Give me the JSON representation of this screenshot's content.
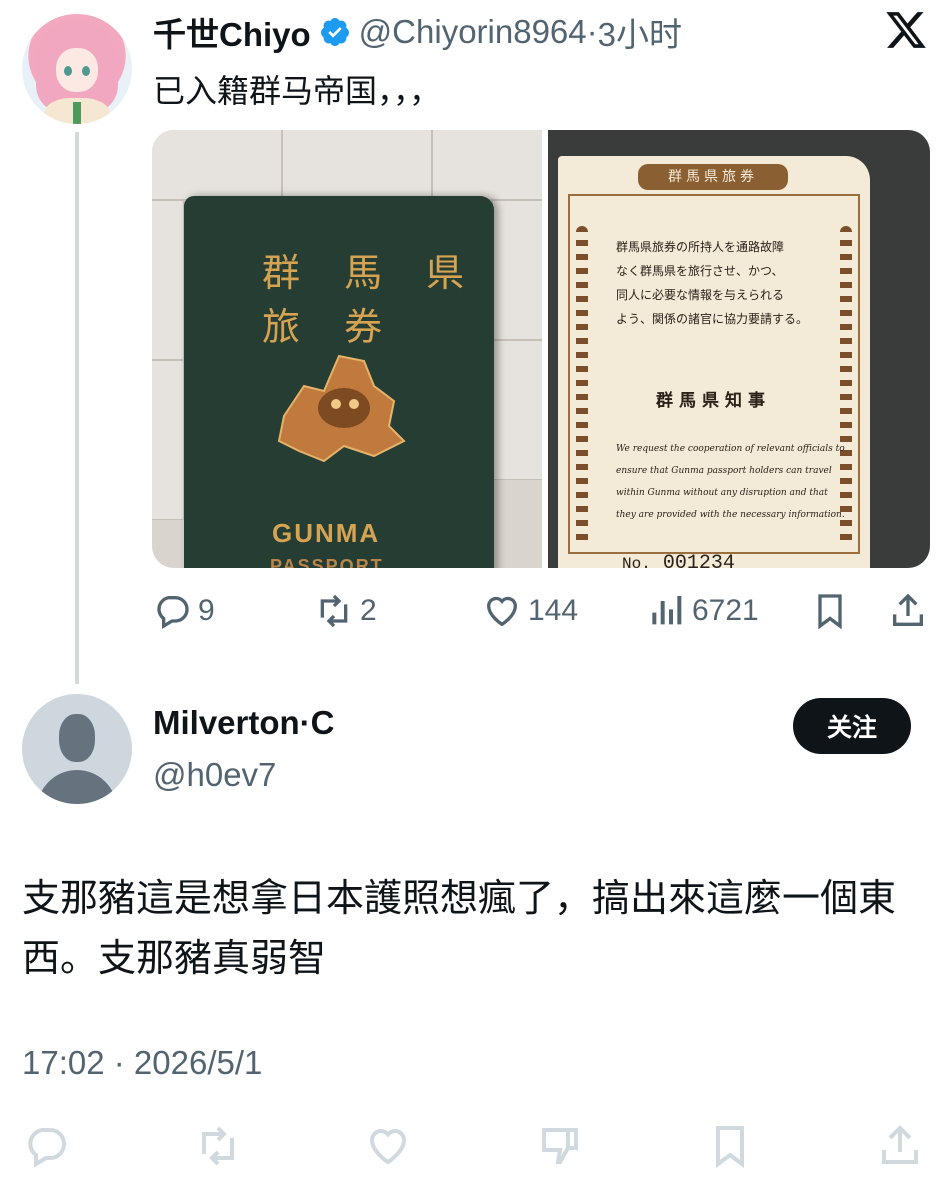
{
  "quoted_tweet": {
    "display_name": "千世Chiyo",
    "handle": "@Chiyorin8964",
    "separator": "·",
    "time_ago": "3小时",
    "text": "已入籍群马帝国，，，",
    "media": {
      "passport_cover": {
        "kanji_line1": "群 馬 県",
        "kanji_line2": "旅   券",
        "title": "GUNMA",
        "subtitle": "PASSPORT"
      },
      "passport_page": {
        "header": "群馬県旅券",
        "jp_lines": [
          "群馬県旅券の所持人を通路故障",
          "なく群馬県を旅行させ、かつ、",
          "同人に必要な情報を与えられる",
          "よう、関係の諸官に協力要請する。"
        ],
        "governor": "群馬県知事",
        "en_lines": [
          "We request the cooperation of relevant officials to",
          "ensure that Gunma passport holders can travel",
          "within Gunma without any disruption and that",
          "they are provided with the necessary information."
        ],
        "serial_label": "No.",
        "serial_number": "001234"
      }
    },
    "actions": {
      "replies": "9",
      "retweets": "2",
      "likes": "144",
      "views": "6721"
    }
  },
  "reply_tweet": {
    "display_name": "Milverton·C",
    "handle": "@h0ev7",
    "follow_label": "关注",
    "text": "支那豬這是想拿日本護照想瘋了，搞出來這麼一個東西。支那豬真弱智",
    "timestamp": "17:02 · 2026/5/1"
  },
  "colors": {
    "text_primary": "#0f1419",
    "text_secondary": "#536471",
    "verified_blue": "#1d9bf0",
    "thread_line": "#cfd9de",
    "button_dark": "#0f1419"
  },
  "icons": [
    "verified-badge-icon",
    "x-logo-icon",
    "reply-icon",
    "retweet-icon",
    "like-icon",
    "views-icon",
    "bookmark-icon",
    "share-icon"
  ]
}
